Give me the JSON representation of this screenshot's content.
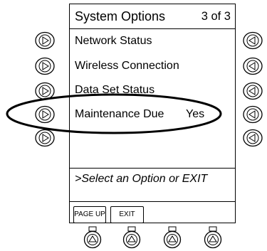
{
  "screen": {
    "title": "System Options",
    "page": "3 of 3",
    "items": [
      {
        "label": "Network Status"
      },
      {
        "label": "Wireless Connection"
      },
      {
        "label": "Data Set Status"
      },
      {
        "label": "Maintenance Due",
        "value": "Yes"
      }
    ],
    "prompt": ">Select an Option or EXIT",
    "softkeys": {
      "page_up": "PAGE UP",
      "exit": "EXIT"
    }
  },
  "icons": {
    "left_buttons": "right-arrow-icon",
    "right_buttons": "left-arrow-icon",
    "bottom_buttons": "up-arrow-icon"
  }
}
